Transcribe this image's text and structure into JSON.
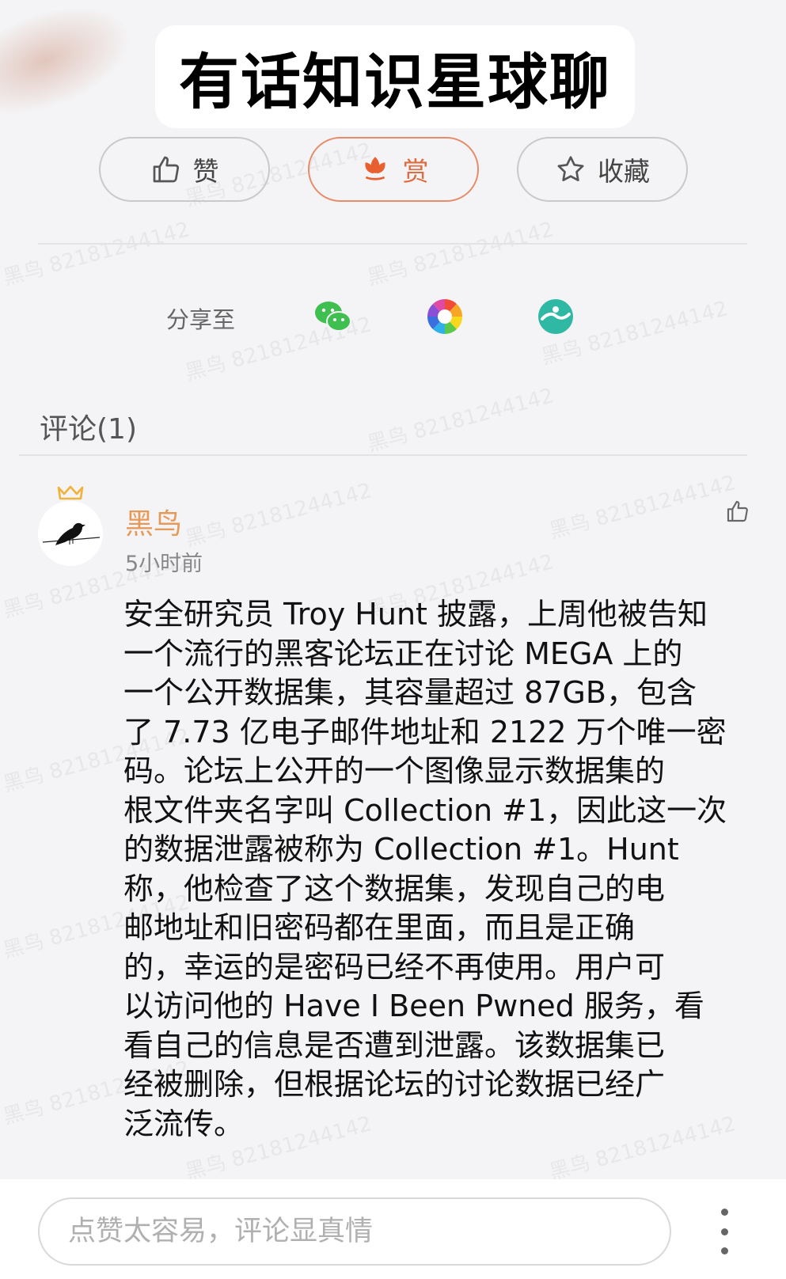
{
  "header": {
    "title": "有话知识星球聊"
  },
  "actions": {
    "like_label": "赞",
    "reward_label": "赏",
    "favorite_label": "收藏"
  },
  "share": {
    "label": "分享至"
  },
  "comments": {
    "header": "评论(1)",
    "items": [
      {
        "username": "黑鸟",
        "timestamp": "5小时前",
        "lines": [
          "安全研究员 Troy Hunt 披露，上周他被告知",
          "一个流行的黑客论坛正在讨论 MEGA 上的",
          "一个公开数据集，其容量超过 87GB，包含",
          "了 7.73 亿电子邮件地址和 2122 万个唯一密",
          "码。论坛上公开的一个图像显示数据集的",
          "根文件夹名字叫 Collection #1，因此这一次",
          "的数据泄露被称为 Collection #1。Hunt",
          "称，他检查了这个数据集，发现自己的电",
          "邮地址和旧密码都在里面，而且是正确",
          "的，幸运的是密码已经不再使用。用户可",
          "以访问他的 Have I Been Pwned 服务，看",
          "看自己的信息是否遭到泄露。该数据集已",
          "经被删除，但根据论坛的讨论数据已经广",
          "泛流传。"
        ]
      }
    ]
  },
  "input": {
    "placeholder": "点赞太容易，评论显真情"
  },
  "watermark": {
    "text": "黑鸟 82181244142"
  },
  "colors": {
    "accent": "#e06b3f",
    "username": "#e69a5a"
  }
}
